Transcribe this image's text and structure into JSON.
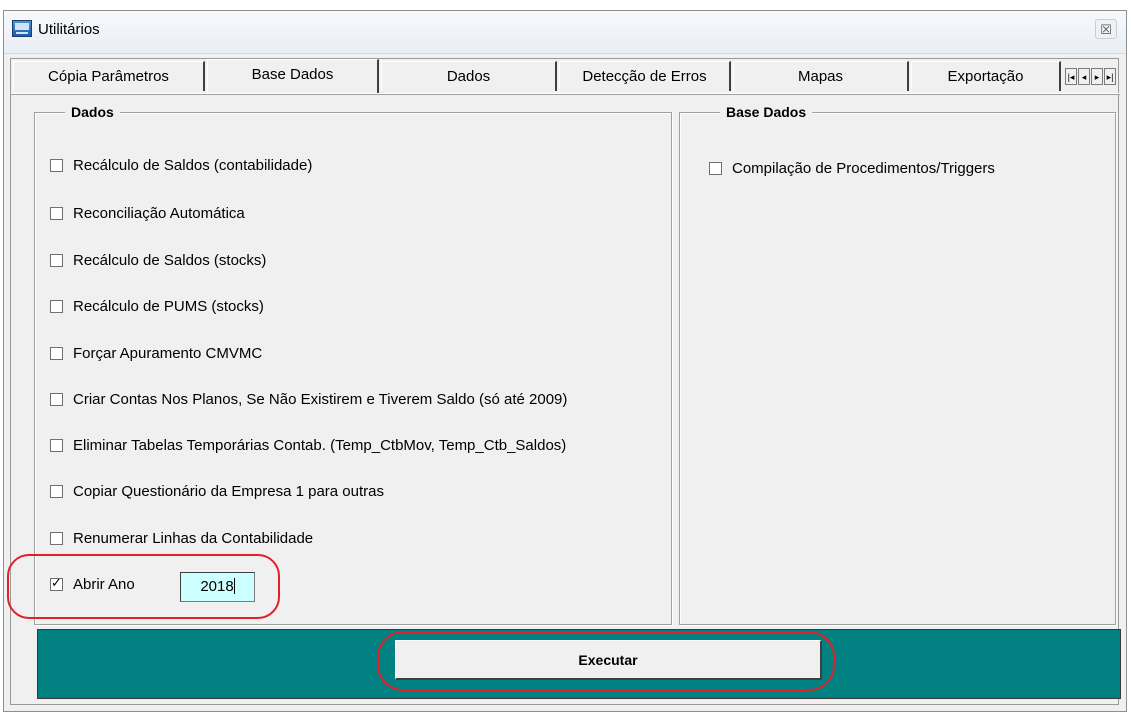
{
  "window": {
    "title": "Utilitários",
    "close_glyph": "☒"
  },
  "tabs": [
    {
      "label": "Cópia Parâmetros"
    },
    {
      "label": "Base Dados"
    },
    {
      "label": "Dados"
    },
    {
      "label": "Detecção de Erros"
    },
    {
      "label": "Mapas"
    },
    {
      "label": "Exportação"
    }
  ],
  "tab_nav": {
    "first": "|◂",
    "prev": "◂",
    "next": "▸",
    "last": "▸|"
  },
  "dados_group": {
    "title": "Dados",
    "options": [
      {
        "label": "Recálculo de Saldos (contabilidade)",
        "checked": false
      },
      {
        "label": "Reconciliação Automática",
        "checked": false
      },
      {
        "label": "Recálculo de Saldos (stocks)",
        "checked": false
      },
      {
        "label": "Recálculo de PUMS (stocks)",
        "checked": false
      },
      {
        "label": "Forçar Apuramento CMVMC",
        "checked": false
      },
      {
        "label": "Criar Contas Nos Planos, Se Não Existirem e Tiverem Saldo (só até 2009)",
        "checked": false
      },
      {
        "label": "Eliminar Tabelas Temporárias Contab. (Temp_CtbMov, Temp_Ctb_Saldos)",
        "checked": false
      },
      {
        "label": "Copiar Questionário da Empresa 1 para outras",
        "checked": false
      },
      {
        "label": "Renumerar Linhas da Contabilidade",
        "checked": false
      },
      {
        "label": "Abrir Ano",
        "checked": true
      }
    ],
    "year_value": "2018"
  },
  "base_dados_group": {
    "title": "Base Dados",
    "options": [
      {
        "label": "Compilação de Procedimentos/Triggers",
        "checked": false
      }
    ]
  },
  "actions": {
    "execute_label": "Executar"
  },
  "colors": {
    "bottom_bar": "#008080",
    "input_background": "#ccffff",
    "highlight_ellipse": "#e0202a"
  }
}
